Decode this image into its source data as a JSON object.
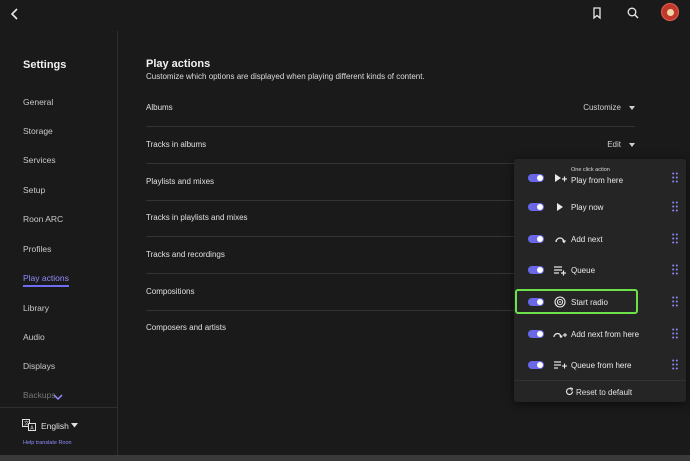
{
  "sidebar": {
    "title": "Settings",
    "items": [
      {
        "label": "General",
        "name": "general"
      },
      {
        "label": "Storage",
        "name": "storage"
      },
      {
        "label": "Services",
        "name": "services"
      },
      {
        "label": "Setup",
        "name": "setup"
      },
      {
        "label": "Roon ARC",
        "name": "roon-arc"
      },
      {
        "label": "Profiles",
        "name": "profiles"
      },
      {
        "label": "Play actions",
        "name": "play-actions"
      },
      {
        "label": "Library",
        "name": "library"
      },
      {
        "label": "Audio",
        "name": "audio"
      },
      {
        "label": "Displays",
        "name": "displays"
      },
      {
        "label": "Backups",
        "name": "backups"
      }
    ],
    "active_item": "Play actions",
    "language": "English",
    "help_link": "Help translate Roon"
  },
  "main": {
    "title": "Play actions",
    "subtitle": "Customize which options are displayed when playing different kinds of content.",
    "rows": [
      {
        "label": "Albums",
        "action": "Customize"
      },
      {
        "label": "Tracks in albums",
        "action": "Edit"
      },
      {
        "label": "Playlists and mixes",
        "action": ""
      },
      {
        "label": "Tracks in playlists and mixes",
        "action": ""
      },
      {
        "label": "Tracks and recordings",
        "action": ""
      },
      {
        "label": "Compositions",
        "action": ""
      },
      {
        "label": "Composers and artists",
        "action": ""
      }
    ]
  },
  "popup": {
    "one_click_label": "One click action",
    "items": [
      {
        "label": "Play from here",
        "icon": "play-from-here-icon",
        "enabled": true
      },
      {
        "label": "Play now",
        "icon": "play-icon",
        "enabled": true
      },
      {
        "label": "Add next",
        "icon": "add-next-icon",
        "enabled": true
      },
      {
        "label": "Queue",
        "icon": "queue-icon",
        "enabled": true
      },
      {
        "label": "Start radio",
        "icon": "radio-icon",
        "enabled": true
      },
      {
        "label": "Add next from here",
        "icon": "add-next-from-here-icon",
        "enabled": true
      },
      {
        "label": "Queue from here",
        "icon": "queue-from-here-icon",
        "enabled": true
      }
    ],
    "reset_label": "Reset to default"
  },
  "colors": {
    "accent": "#6a68e8",
    "highlight": "#6ee04a",
    "background": "#1a1a1a",
    "popup_background": "#252525"
  }
}
